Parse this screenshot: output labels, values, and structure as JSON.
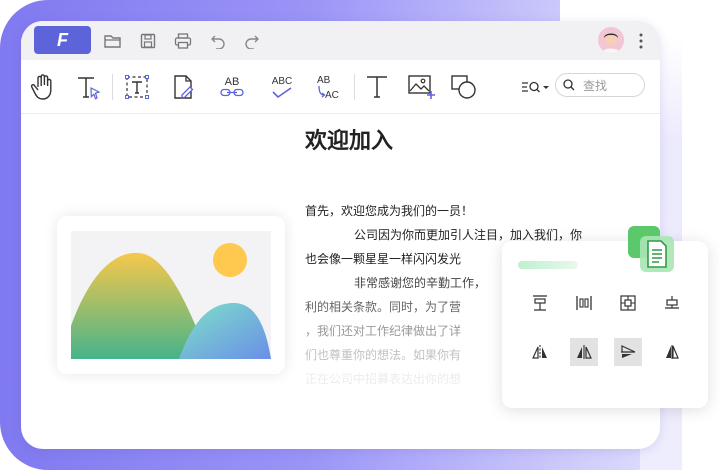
{
  "app": {
    "logo_letter": "F"
  },
  "titlebar": {
    "icons": [
      "open-folder-icon",
      "save-icon",
      "print-icon",
      "undo-icon",
      "redo-icon"
    ]
  },
  "toolbar": {
    "tools": [
      "hand-icon",
      "text-select-icon",
      "text-box-icon",
      "edit-page-icon",
      "replace-text-icon",
      "spell-check-icon",
      "convert-case-icon",
      "text-icon",
      "add-image-icon",
      "shapes-icon"
    ],
    "replace_label_top": "AB",
    "spell_label": "ABC",
    "case_top": "AB",
    "case_bottom": "AC",
    "search_placeholder": "查找"
  },
  "document": {
    "title": "欢迎加入",
    "lines": [
      "首先，欢迎您成为我们的一员！",
      "公司因为你而更加引人注目，加入我们，你",
      "也会像一颗星星一样闪闪发光",
      "非常感谢您的辛勤工作，",
      "利的相关条款。同时，为了营",
      "，我们还对工作纪律做出了详",
      "们也尊重你的想法。如果你有",
      "正在公司中招募表达出你的想"
    ]
  },
  "panel": {
    "row1": [
      "align-top-icon",
      "align-vcenter-icon",
      "align-center-icon",
      "align-bottom-icon"
    ],
    "row2": [
      "flip-horizontal-icon",
      "flip-horizontal-active-icon",
      "rotate-right-icon",
      "flip-vertical-icon"
    ]
  },
  "colors": {
    "accent": "#5d64d9",
    "frame": "#8079f0",
    "badge": "#5bc96b"
  }
}
